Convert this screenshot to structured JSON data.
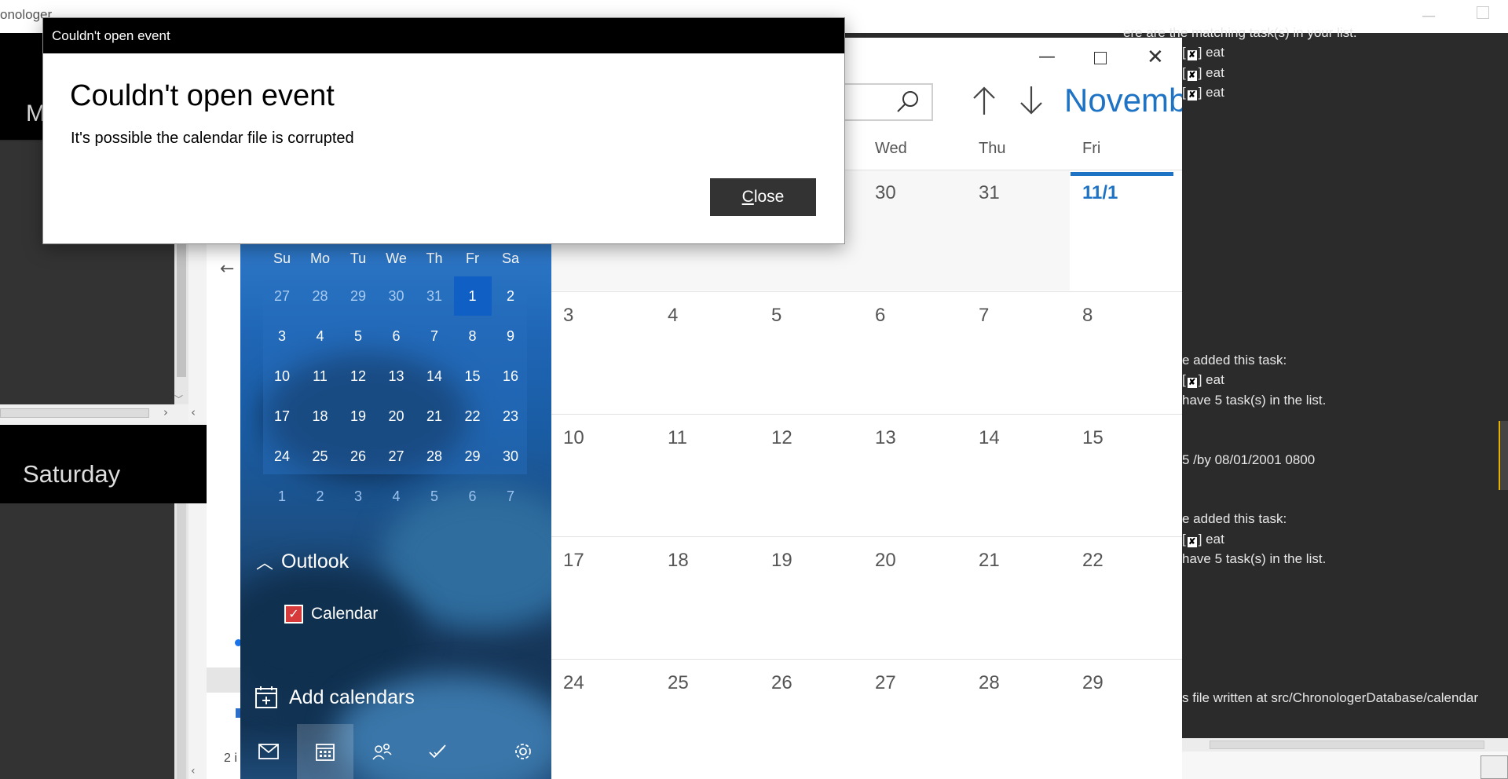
{
  "background_app": {
    "title": "onologer",
    "left_label_m": "M",
    "left_label_saturday": "Saturday",
    "explorer_count": "2 i",
    "console_lines": [
      {
        "text": "ere are the matching task(s) in your list.",
        "top": 0
      },
      {
        "prefix": "[",
        "checked": "✘",
        "suffix": "] eat"
      },
      {
        "prefix": "[",
        "checked": "✘",
        "suffix": "] eat"
      },
      {
        "prefix": "[",
        "checked": "✘",
        "suffix": "] eat"
      }
    ],
    "console_text": {
      "matching": "ere are the matching task(s) in your list.",
      "eat": "] eat",
      "open_bracket": "[",
      "cross": "✘",
      "added1": "e added this task:",
      "have1": "have 5 task(s) in the list.",
      "by_line": "5 /by 08/01/2001 0800",
      "added2": "e added this task:",
      "have2": "have 5 task(s) in the list.",
      "file_written": "s file written at src/ChronologerDatabase/calendar"
    }
  },
  "dialog": {
    "window_title": "Couldn't open event",
    "heading": "Couldn't open event",
    "message": "It's possible the calendar file is corrupted",
    "close_accel": "C",
    "close_rest": "lose"
  },
  "calendar_app": {
    "month_title": "November",
    "weekday_headers_visible": [
      "Wed",
      "Thu",
      "Fri"
    ],
    "mini_calendar": {
      "day_headers": [
        "Su",
        "Mo",
        "Tu",
        "We",
        "Th",
        "Fr",
        "Sa"
      ],
      "weeks": [
        [
          "27",
          "28",
          "29",
          "30",
          "31",
          "1",
          "2"
        ],
        [
          "3",
          "4",
          "5",
          "6",
          "7",
          "8",
          "9"
        ],
        [
          "10",
          "11",
          "12",
          "13",
          "14",
          "15",
          "16"
        ],
        [
          "17",
          "18",
          "19",
          "20",
          "21",
          "22",
          "23"
        ],
        [
          "24",
          "25",
          "26",
          "27",
          "28",
          "29",
          "30"
        ],
        [
          "1",
          "2",
          "3",
          "4",
          "5",
          "6",
          "7"
        ]
      ],
      "today": "1"
    },
    "accounts": {
      "outlook_label": "Outlook",
      "calendar_label": "Calendar",
      "add_calendars": "Add calendars"
    },
    "month_grid": {
      "rows": [
        [
          "30",
          "31",
          "11/1"
        ],
        [
          "3",
          "4",
          "5",
          "6",
          "7",
          "8"
        ],
        [
          "10",
          "11",
          "12",
          "13",
          "14",
          "15"
        ],
        [
          "17",
          "18",
          "19",
          "20",
          "21",
          "22"
        ],
        [
          "24",
          "25",
          "26",
          "27",
          "28",
          "29"
        ]
      ]
    },
    "bottom_nav": [
      "mail-icon",
      "calendar-icon",
      "people-icon",
      "todo-icon",
      "settings-icon"
    ]
  },
  "colors": {
    "accent": "#1e73c4",
    "dialog_titlebar": "#000000",
    "close_button": "#333333",
    "checkbox": "#d73a3a"
  }
}
